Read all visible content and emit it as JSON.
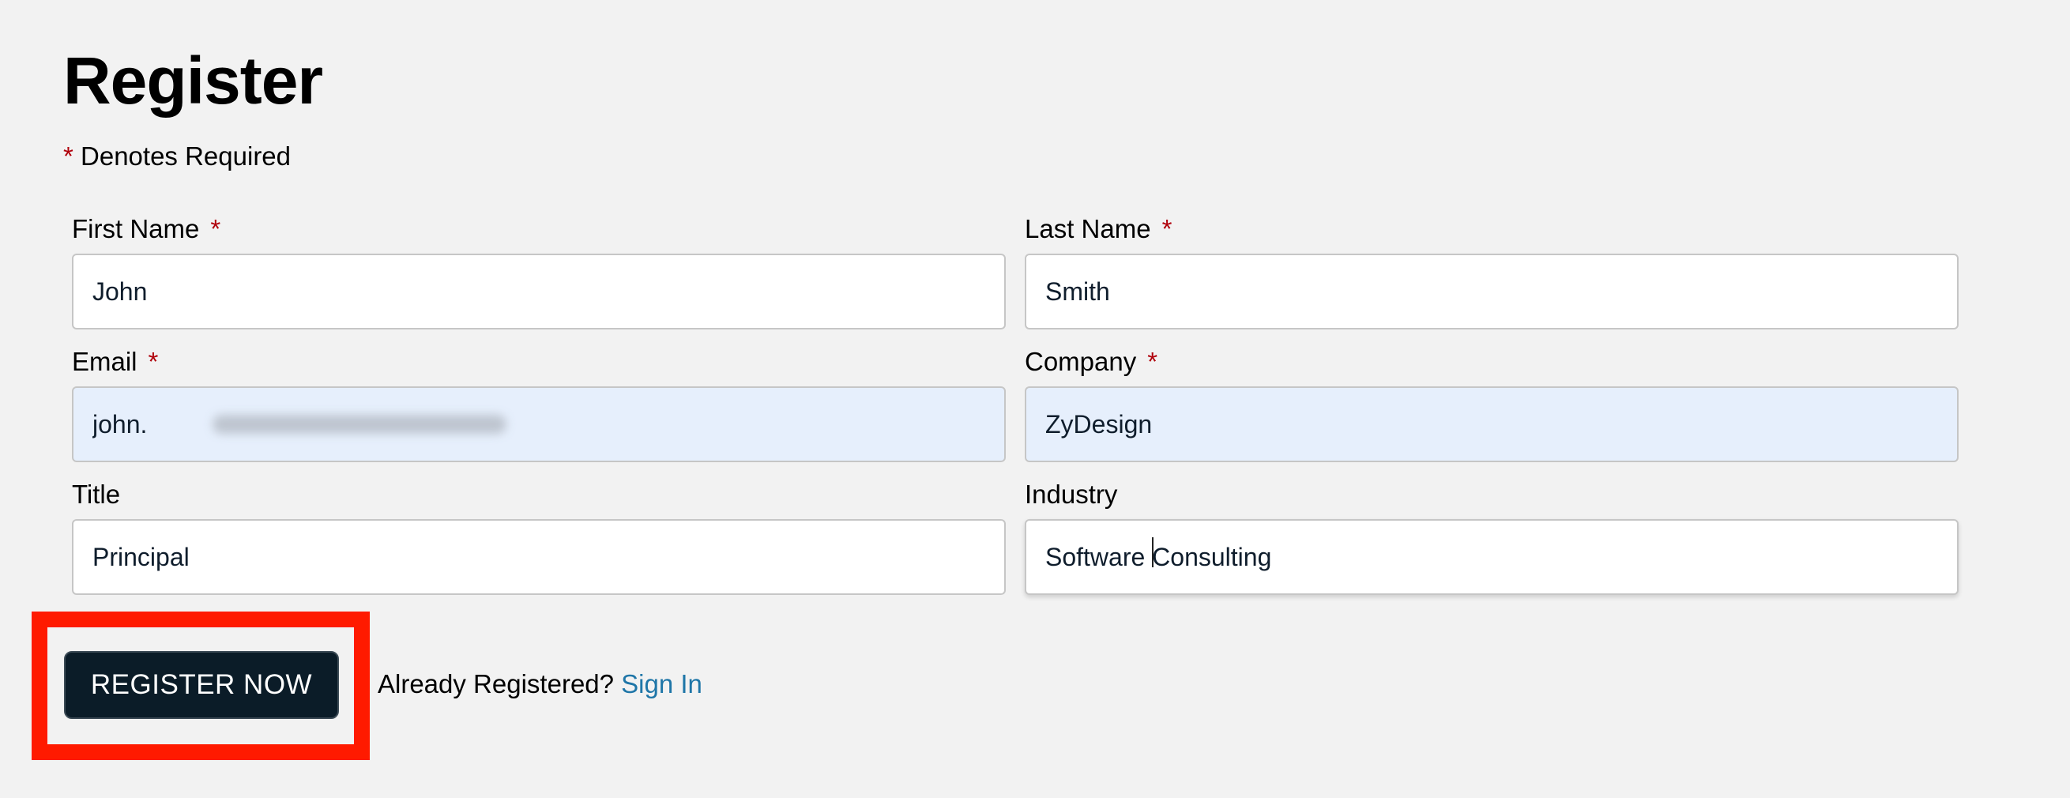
{
  "page": {
    "title": "Register",
    "required_mark": "*",
    "required_note": "Denotes Required"
  },
  "form": {
    "first_name": {
      "label": "First Name",
      "required": "*",
      "value": "John"
    },
    "last_name": {
      "label": "Last Name",
      "required": "*",
      "value": "Smith"
    },
    "email": {
      "label": "Email",
      "required": "*",
      "value": "john."
    },
    "company": {
      "label": "Company",
      "required": "*",
      "value": "ZyDesign"
    },
    "title": {
      "label": "Title",
      "value": "Principal"
    },
    "industry": {
      "label": "Industry",
      "value": "Software Consulting"
    }
  },
  "actions": {
    "register_label": "REGISTER NOW",
    "already_text": "Already Registered?",
    "signin_label": "Sign In"
  },
  "colors": {
    "page_background": "#f2f2f2",
    "required_asterisk": "#b0000b",
    "autofill_background": "#e6effc",
    "button_background": "#0b1c28",
    "link": "#1f76a8",
    "highlight": "#ff1a00"
  }
}
